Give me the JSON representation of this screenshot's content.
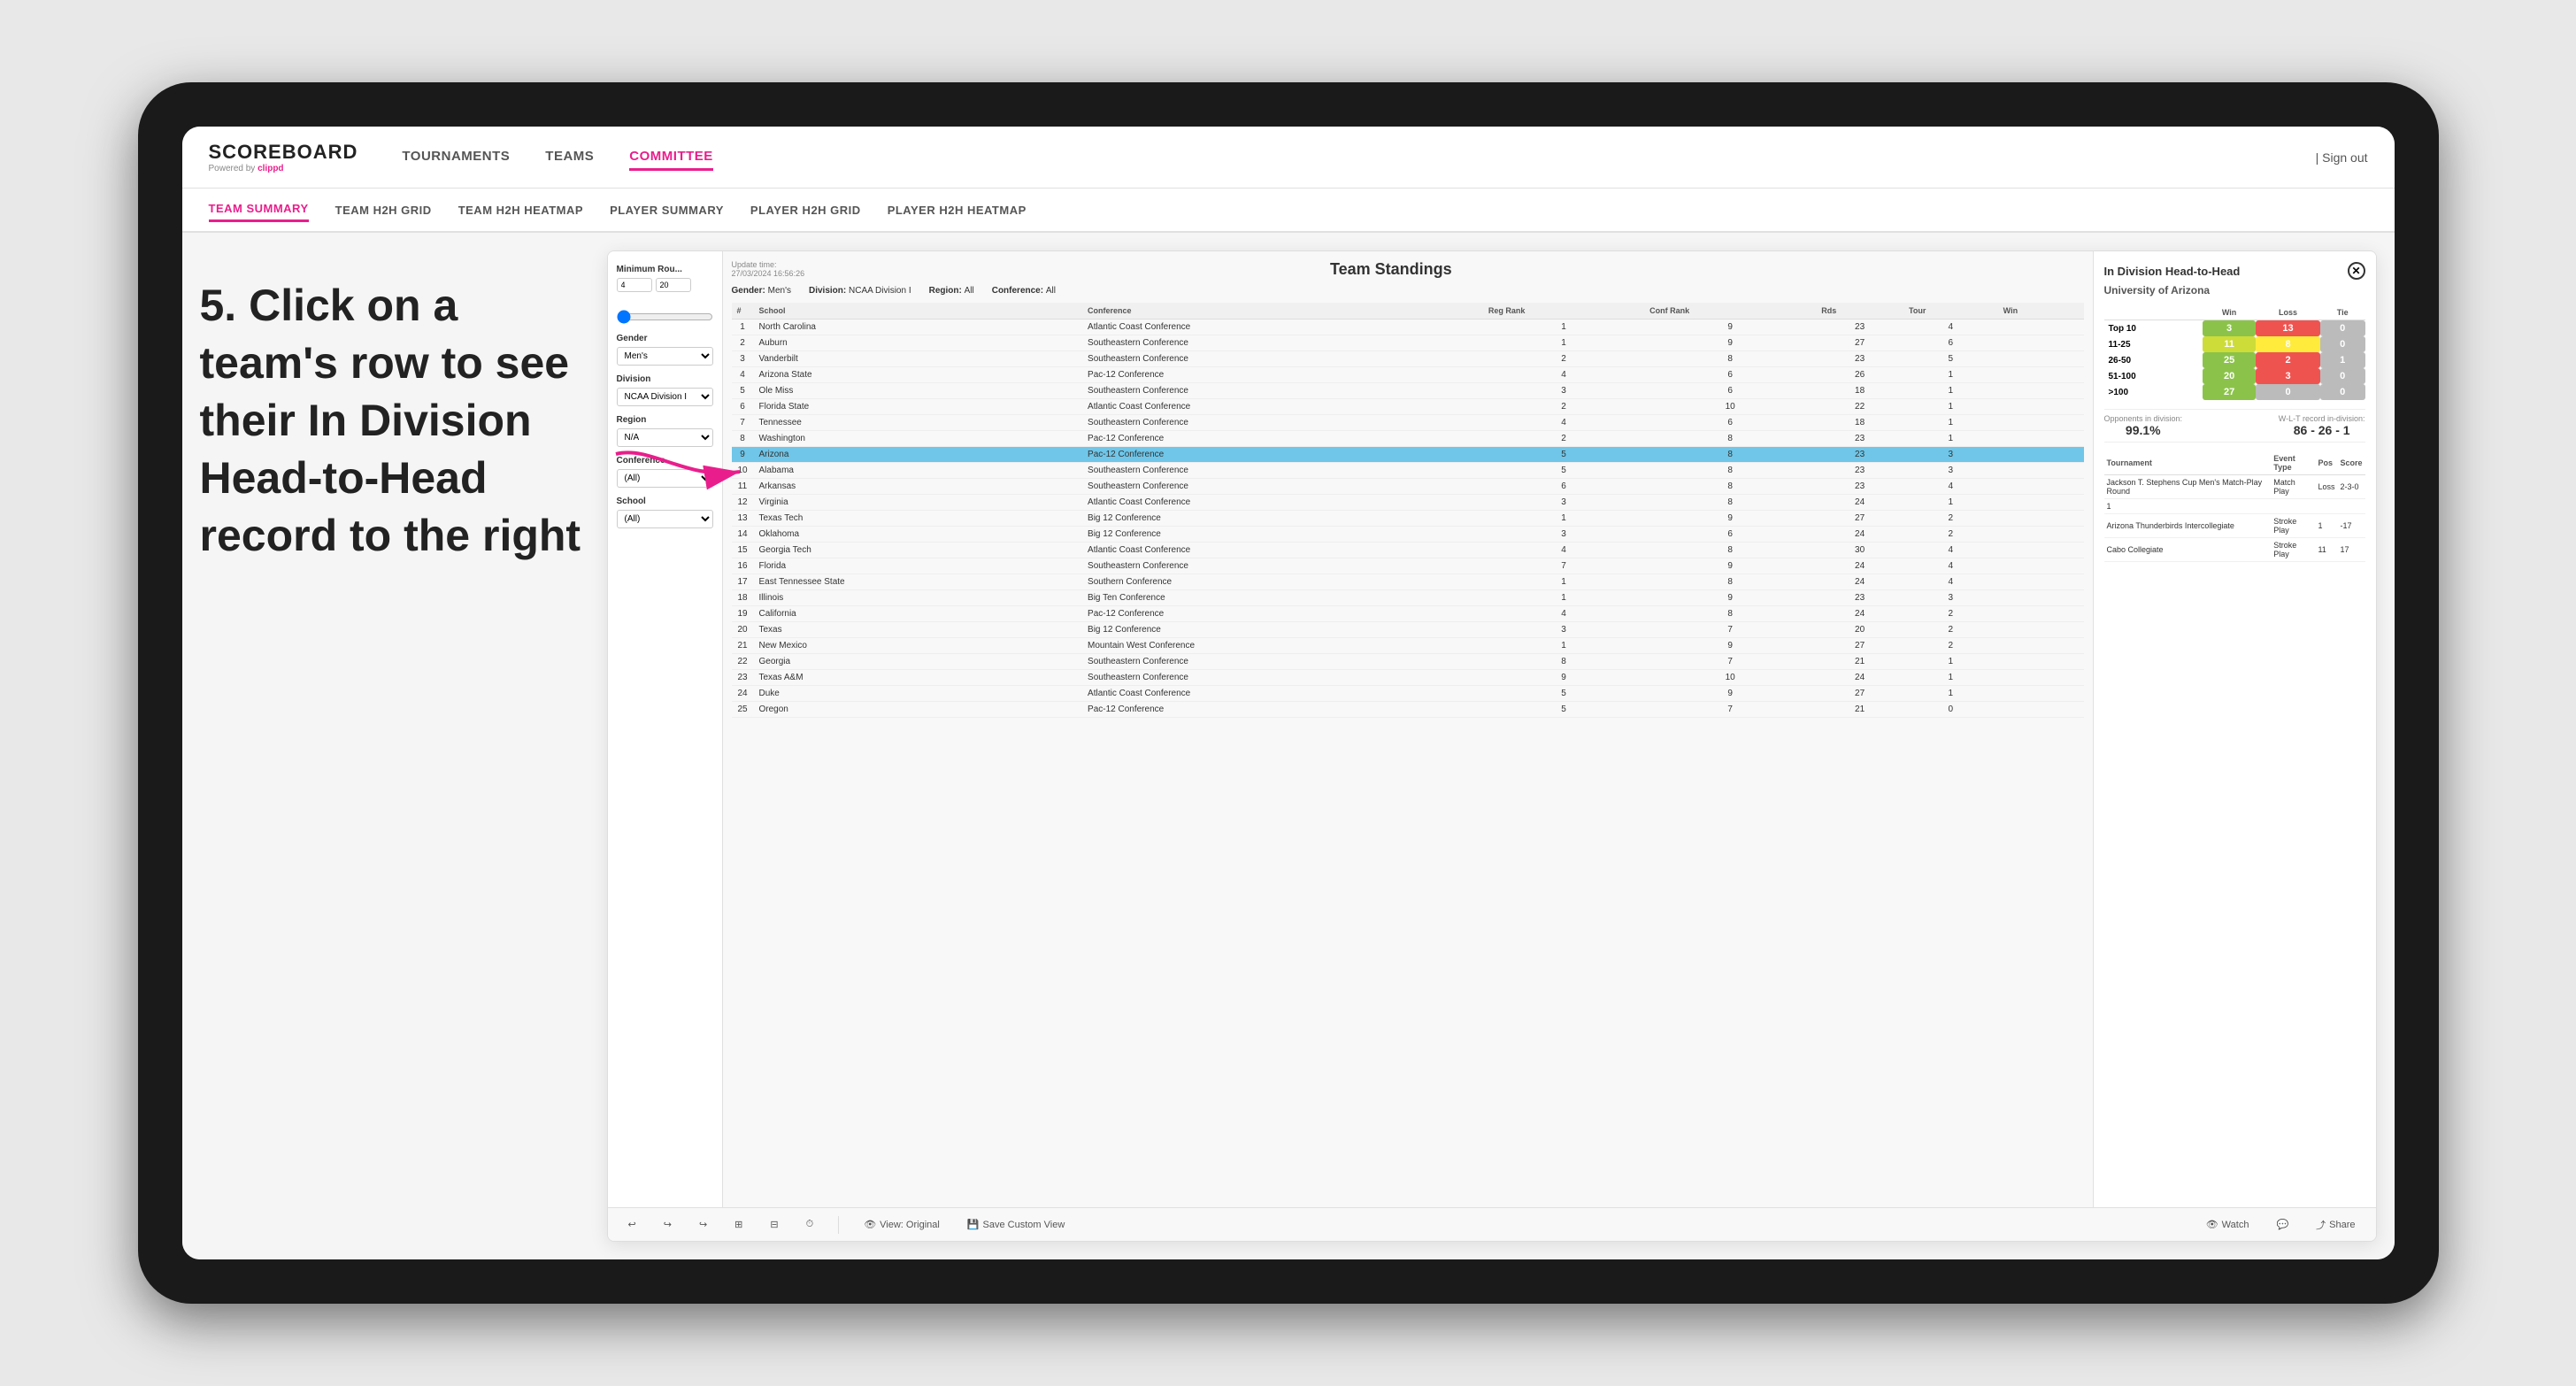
{
  "device": {
    "background": "#1a1a1a"
  },
  "instruction": {
    "step": "5. Click on a team's row to see their In Division Head-to-Head record to the right"
  },
  "app": {
    "logo": "SCOREBOARD",
    "logo_sub": "Powered by clippd",
    "nav_items": [
      "TOURNAMENTS",
      "TEAMS",
      "COMMITTEE"
    ],
    "sign_out": "Sign out",
    "active_nav": "COMMITTEE",
    "sub_nav_items": [
      "TEAM SUMMARY",
      "TEAM H2H GRID",
      "TEAM H2H HEATMAP",
      "PLAYER SUMMARY",
      "PLAYER H2H GRID",
      "PLAYER H2H HEATMAP"
    ],
    "active_sub_nav": "TEAM SUMMARY"
  },
  "standings": {
    "update_time_label": "Update time:",
    "update_time": "27/03/2024 16:56:26",
    "title": "Team Standings",
    "gender_label": "Gender:",
    "gender": "Men's",
    "division_label": "Division:",
    "division": "NCAA Division I",
    "region_label": "Region:",
    "region": "All",
    "conference_label": "Conference:",
    "conference": "All"
  },
  "filters": {
    "min_rounds_label": "Minimum Rou...",
    "min_rounds_val1": "4",
    "min_rounds_val2": "20",
    "gender_label": "Gender",
    "gender_val": "Men's",
    "division_label": "Division",
    "division_val": "NCAA Division I",
    "region_label": "Region",
    "region_val": "N/A",
    "conference_label": "Conference",
    "conference_val": "(All)",
    "school_label": "School",
    "school_val": "(All)"
  },
  "table_headers": [
    "#",
    "School",
    "Conference",
    "Reg Rank",
    "Conf Rank",
    "Rds",
    "Tour",
    "Win"
  ],
  "teams": [
    {
      "rank": 1,
      "school": "North Carolina",
      "conference": "Atlantic Coast Conference",
      "reg_rank": 1,
      "conf_rank": 9,
      "rds": 23,
      "tour": 4,
      "win": ""
    },
    {
      "rank": 2,
      "school": "Auburn",
      "conference": "Southeastern Conference",
      "reg_rank": 1,
      "conf_rank": 9,
      "rds": 27,
      "tour": 6,
      "win": ""
    },
    {
      "rank": 3,
      "school": "Vanderbilt",
      "conference": "Southeastern Conference",
      "reg_rank": 2,
      "conf_rank": 8,
      "rds": 23,
      "tour": 5,
      "win": ""
    },
    {
      "rank": 4,
      "school": "Arizona State",
      "conference": "Pac-12 Conference",
      "reg_rank": 4,
      "conf_rank": 6,
      "rds": 26,
      "tour": 1,
      "win": ""
    },
    {
      "rank": 5,
      "school": "Ole Miss",
      "conference": "Southeastern Conference",
      "reg_rank": 3,
      "conf_rank": 6,
      "rds": 18,
      "tour": 1,
      "win": ""
    },
    {
      "rank": 6,
      "school": "Florida State",
      "conference": "Atlantic Coast Conference",
      "reg_rank": 2,
      "conf_rank": 10,
      "rds": 22,
      "tour": 1,
      "win": ""
    },
    {
      "rank": 7,
      "school": "Tennessee",
      "conference": "Southeastern Conference",
      "reg_rank": 4,
      "conf_rank": 6,
      "rds": 18,
      "tour": 1,
      "win": ""
    },
    {
      "rank": 8,
      "school": "Washington",
      "conference": "Pac-12 Conference",
      "reg_rank": 2,
      "conf_rank": 8,
      "rds": 23,
      "tour": 1,
      "win": ""
    },
    {
      "rank": 9,
      "school": "Arizona",
      "conference": "Pac-12 Conference",
      "reg_rank": 5,
      "conf_rank": 8,
      "rds": 23,
      "tour": 3,
      "win": "",
      "highlighted": true
    },
    {
      "rank": 10,
      "school": "Alabama",
      "conference": "Southeastern Conference",
      "reg_rank": 5,
      "conf_rank": 8,
      "rds": 23,
      "tour": 3,
      "win": ""
    },
    {
      "rank": 11,
      "school": "Arkansas",
      "conference": "Southeastern Conference",
      "reg_rank": 6,
      "conf_rank": 8,
      "rds": 23,
      "tour": 4,
      "win": ""
    },
    {
      "rank": 12,
      "school": "Virginia",
      "conference": "Atlantic Coast Conference",
      "reg_rank": 3,
      "conf_rank": 8,
      "rds": 24,
      "tour": 1,
      "win": ""
    },
    {
      "rank": 13,
      "school": "Texas Tech",
      "conference": "Big 12 Conference",
      "reg_rank": 1,
      "conf_rank": 9,
      "rds": 27,
      "tour": 2,
      "win": ""
    },
    {
      "rank": 14,
      "school": "Oklahoma",
      "conference": "Big 12 Conference",
      "reg_rank": 3,
      "conf_rank": 6,
      "rds": 24,
      "tour": 2,
      "win": ""
    },
    {
      "rank": 15,
      "school": "Georgia Tech",
      "conference": "Atlantic Coast Conference",
      "reg_rank": 4,
      "conf_rank": 8,
      "rds": 30,
      "tour": 4,
      "win": ""
    },
    {
      "rank": 16,
      "school": "Florida",
      "conference": "Southeastern Conference",
      "reg_rank": 7,
      "conf_rank": 9,
      "rds": 24,
      "tour": 4,
      "win": ""
    },
    {
      "rank": 17,
      "school": "East Tennessee State",
      "conference": "Southern Conference",
      "reg_rank": 1,
      "conf_rank": 8,
      "rds": 24,
      "tour": 4,
      "win": ""
    },
    {
      "rank": 18,
      "school": "Illinois",
      "conference": "Big Ten Conference",
      "reg_rank": 1,
      "conf_rank": 9,
      "rds": 23,
      "tour": 3,
      "win": ""
    },
    {
      "rank": 19,
      "school": "California",
      "conference": "Pac-12 Conference",
      "reg_rank": 4,
      "conf_rank": 8,
      "rds": 24,
      "tour": 2,
      "win": ""
    },
    {
      "rank": 20,
      "school": "Texas",
      "conference": "Big 12 Conference",
      "reg_rank": 3,
      "conf_rank": 7,
      "rds": 20,
      "tour": 2,
      "win": ""
    },
    {
      "rank": 21,
      "school": "New Mexico",
      "conference": "Mountain West Conference",
      "reg_rank": 1,
      "conf_rank": 9,
      "rds": 27,
      "tour": 2,
      "win": ""
    },
    {
      "rank": 22,
      "school": "Georgia",
      "conference": "Southeastern Conference",
      "reg_rank": 8,
      "conf_rank": 7,
      "rds": 21,
      "tour": 1,
      "win": ""
    },
    {
      "rank": 23,
      "school": "Texas A&M",
      "conference": "Southeastern Conference",
      "reg_rank": 9,
      "conf_rank": 10,
      "rds": 24,
      "tour": 1,
      "win": ""
    },
    {
      "rank": 24,
      "school": "Duke",
      "conference": "Atlantic Coast Conference",
      "reg_rank": 5,
      "conf_rank": 9,
      "rds": 27,
      "tour": 1,
      "win": ""
    },
    {
      "rank": 25,
      "school": "Oregon",
      "conference": "Pac-12 Conference",
      "reg_rank": 5,
      "conf_rank": 7,
      "rds": 21,
      "tour": 0,
      "win": ""
    }
  ],
  "h2h": {
    "title": "In Division Head-to-Head",
    "team_name": "University of Arizona",
    "win_label": "Win",
    "loss_label": "Loss",
    "tie_label": "Tie",
    "rows": [
      {
        "range": "Top 10",
        "win": 3,
        "loss": 13,
        "tie": 0,
        "win_color": "green",
        "loss_color": "red"
      },
      {
        "range": "11-25",
        "win": 11,
        "loss": 8,
        "tie": 0,
        "win_color": "yellow",
        "loss_color": "yellow"
      },
      {
        "range": "26-50",
        "win": 25,
        "loss": 2,
        "tie": 1,
        "win_color": "green",
        "loss_color": "gray"
      },
      {
        "range": "51-100",
        "win": 20,
        "loss": 3,
        "tie": 0,
        "win_color": "green",
        "loss_color": "gray"
      },
      {
        "range": ">100",
        "win": 27,
        "loss": 0,
        "tie": 0,
        "win_color": "green",
        "loss_color": "gray"
      }
    ],
    "opponents_label": "Opponents in division:",
    "opponents_val": "99.1%",
    "wlt_label": "W-L-T record in-division:",
    "wlt_val": "86 - 26 - 1",
    "tournament_headers": [
      "Tournament",
      "Event Type",
      "Pos",
      "Score"
    ],
    "tournaments": [
      {
        "name": "Jackson T. Stephens Cup Men's Match-Play Round",
        "type": "Match Play",
        "result": "Loss",
        "score": "2-3-0"
      },
      {
        "name": "1",
        "type": "",
        "result": "",
        "score": ""
      },
      {
        "name": "Arizona Thunderbirds Intercollegiate",
        "type": "Stroke Play",
        "result": "1",
        "score": "-17"
      },
      {
        "name": "Cabo Collegiate",
        "type": "Stroke Play",
        "result": "11",
        "score": "17"
      }
    ]
  },
  "toolbar": {
    "undo": "↩",
    "redo_partial": "↪",
    "redo": "↪",
    "copy": "⊞",
    "paste": "⊟",
    "clock": "⏱",
    "view_original": "View: Original",
    "save_custom": "Save Custom View",
    "watch": "Watch",
    "share": "Share"
  }
}
